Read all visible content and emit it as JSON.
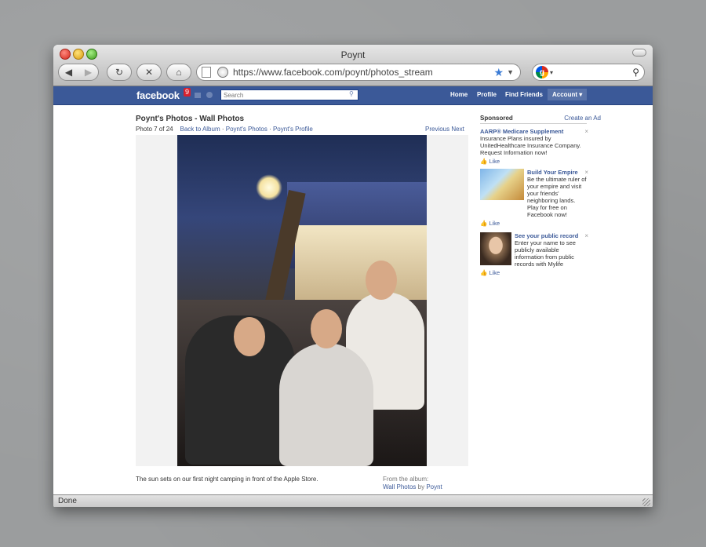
{
  "window": {
    "title": "Poynt"
  },
  "toolbar": {
    "back_icon": "back-arrow-icon",
    "forward_icon": "forward-arrow-icon",
    "reload_symbol": "↻",
    "stop_symbol": "✕",
    "home_symbol": "⌂",
    "url": "https://www.facebook.com/poynt/photos_stream",
    "search_value": ""
  },
  "facebook": {
    "logo": "facebook",
    "notification_count": "9",
    "search_placeholder": "Search",
    "nav": {
      "home": "Home",
      "profile": "Profile",
      "find_friends": "Find Friends",
      "account": "Account ▾"
    }
  },
  "album": {
    "title": "Poynt's Photos - Wall Photos",
    "photo_index": "Photo 7 of 24",
    "links": [
      "Back to Album",
      "Poynt's Photos",
      "Poynt's Profile"
    ],
    "previous": "Previous",
    "next": "Next",
    "caption": "The sun sets on our first night camping in front of the Apple Store.",
    "from_album_label": "From the album:",
    "from_album_link": "Wall Photos",
    "by_label": "by",
    "by_link": "Poynt"
  },
  "sponsored": {
    "title": "Sponsored",
    "create_ad": "Create an Ad",
    "ads": [
      {
        "title": "AARP® Medicare Supplement",
        "body": "Insurance Plans insured by UnitedHealthcare Insurance Company. Request Information now!",
        "like": "Like"
      },
      {
        "title": "Build Your Empire",
        "body": "Be the ultimate ruler of your empire and visit your friends' neighboring lands. Play for free on Facebook now!",
        "like": "Like"
      },
      {
        "title": "See your public record",
        "body": "Enter your name to see publicly available information from public records with Mylife",
        "like": "Like"
      }
    ]
  },
  "status": {
    "text": "Done"
  },
  "colors": {
    "facebook_blue": "#3b5998",
    "link": "#3b5998"
  }
}
